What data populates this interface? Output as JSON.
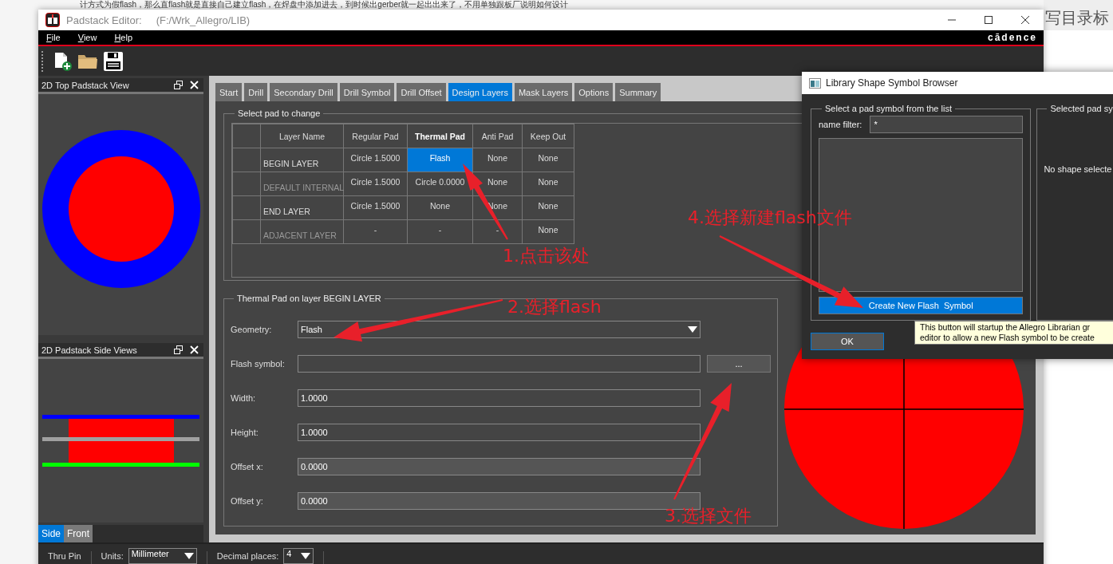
{
  "background_page": {
    "article_line": "计方式为假flash，那么直flash就是直接自己建立flash，在焊盘中添加进去，到时候出gerber就一起出出来了，不用单独跟板厂说明如何设计",
    "sidebar_heading": "写目录标"
  },
  "window": {
    "title": "Padstack Editor:",
    "path": "(F:/Wrk_Allegro/LIB)",
    "brand": "cādence"
  },
  "menu": [
    {
      "label": "File"
    },
    {
      "label": "View"
    },
    {
      "label": "Help"
    }
  ],
  "panels": {
    "top_view": {
      "title": "2D Top Padstack View"
    },
    "side_view": {
      "title": "2D Padstack Side Views",
      "tabs": [
        {
          "label": "Side",
          "selected": true
        },
        {
          "label": "Front",
          "selected": false
        }
      ]
    }
  },
  "tabs": [
    {
      "label": "Start",
      "selected": false
    },
    {
      "label": "Drill",
      "selected": false
    },
    {
      "label": "Secondary Drill",
      "selected": false
    },
    {
      "label": "Drill Symbol",
      "selected": false
    },
    {
      "label": "Drill Offset",
      "selected": false
    },
    {
      "label": "Design Layers",
      "selected": true
    },
    {
      "label": "Mask Layers",
      "selected": false
    },
    {
      "label": "Options",
      "selected": false
    },
    {
      "label": "Summary",
      "selected": false
    }
  ],
  "pad_table": {
    "title": "Select pad to change",
    "columns": [
      {
        "label": "Layer Name",
        "selected": false
      },
      {
        "label": "Regular Pad",
        "selected": false
      },
      {
        "label": "Thermal Pad",
        "selected": true
      },
      {
        "label": "Anti Pad",
        "selected": false
      },
      {
        "label": "Keep Out",
        "selected": false
      }
    ],
    "rows": [
      {
        "disabled": false,
        "cells": [
          {
            "text": "BEGIN LAYER",
            "selected": false
          },
          {
            "text": "Circle 1.5000",
            "selected": false
          },
          {
            "text": "Flash",
            "selected": true
          },
          {
            "text": "None",
            "selected": false
          },
          {
            "text": "None",
            "selected": false
          }
        ]
      },
      {
        "disabled": true,
        "cells": [
          {
            "text": "DEFAULT INTERNAL",
            "selected": false
          },
          {
            "text": "Circle 1.5000",
            "selected": false
          },
          {
            "text": "Circle 0.0000",
            "selected": false
          },
          {
            "text": "None",
            "selected": false
          },
          {
            "text": "None",
            "selected": false
          }
        ]
      },
      {
        "disabled": false,
        "cells": [
          {
            "text": "END LAYER",
            "selected": false
          },
          {
            "text": "Circle 1.5000",
            "selected": false
          },
          {
            "text": "None",
            "selected": false
          },
          {
            "text": "None",
            "selected": false
          },
          {
            "text": "None",
            "selected": false
          }
        ]
      },
      {
        "disabled": true,
        "cells": [
          {
            "text": "ADJACENT LAYER",
            "selected": false
          },
          {
            "text": "-",
            "selected": false
          },
          {
            "text": "-",
            "selected": false
          },
          {
            "text": "-",
            "selected": false
          },
          {
            "text": "None",
            "selected": false
          }
        ]
      }
    ]
  },
  "thermal_form": {
    "title": "Thermal Pad on layer BEGIN LAYER",
    "fields": [
      {
        "kind": "dropdown",
        "label": "Geometry:",
        "value": "Flash",
        "disabled": false
      },
      {
        "kind": "browse",
        "label": "Flash symbol:",
        "button": "...",
        "disabled": false
      },
      {
        "kind": "text",
        "label": "Width:",
        "value": "1.0000",
        "disabled": false
      },
      {
        "kind": "text",
        "label": "Height:",
        "value": "1.0000",
        "disabled": false
      },
      {
        "kind": "text",
        "label": "Offset x:",
        "value": "0.0000",
        "disabled": true
      },
      {
        "kind": "text",
        "label": "Offset y:",
        "value": "0.0000",
        "disabled": true
      }
    ]
  },
  "status_bar": {
    "mode": "Thru Pin",
    "units_label": "Units:",
    "units": "Millimeter",
    "decimal_label": "Decimal places:",
    "decimal": "4"
  },
  "dialog": {
    "title": "Library Shape Symbol Browser",
    "list_group": {
      "title": "Select a pad symbol from the list",
      "filter_label": "name filter:",
      "filter_value": "*",
      "create_button": "Create New Flash  Symbol"
    },
    "preview_group": {
      "title": "Selected pad sy",
      "empty_text": "No shape selecte"
    },
    "ok_button": "OK",
    "tooltip": [
      "This button will startup the Allegro Librarian gr",
      "editor to allow a new Flash symbol to be create"
    ]
  },
  "annotations": [
    {
      "text": "1.点击该处"
    },
    {
      "text": "2.选择flash"
    },
    {
      "text": "3.选择文件"
    },
    {
      "text": "4.选择新建flash文件"
    }
  ]
}
